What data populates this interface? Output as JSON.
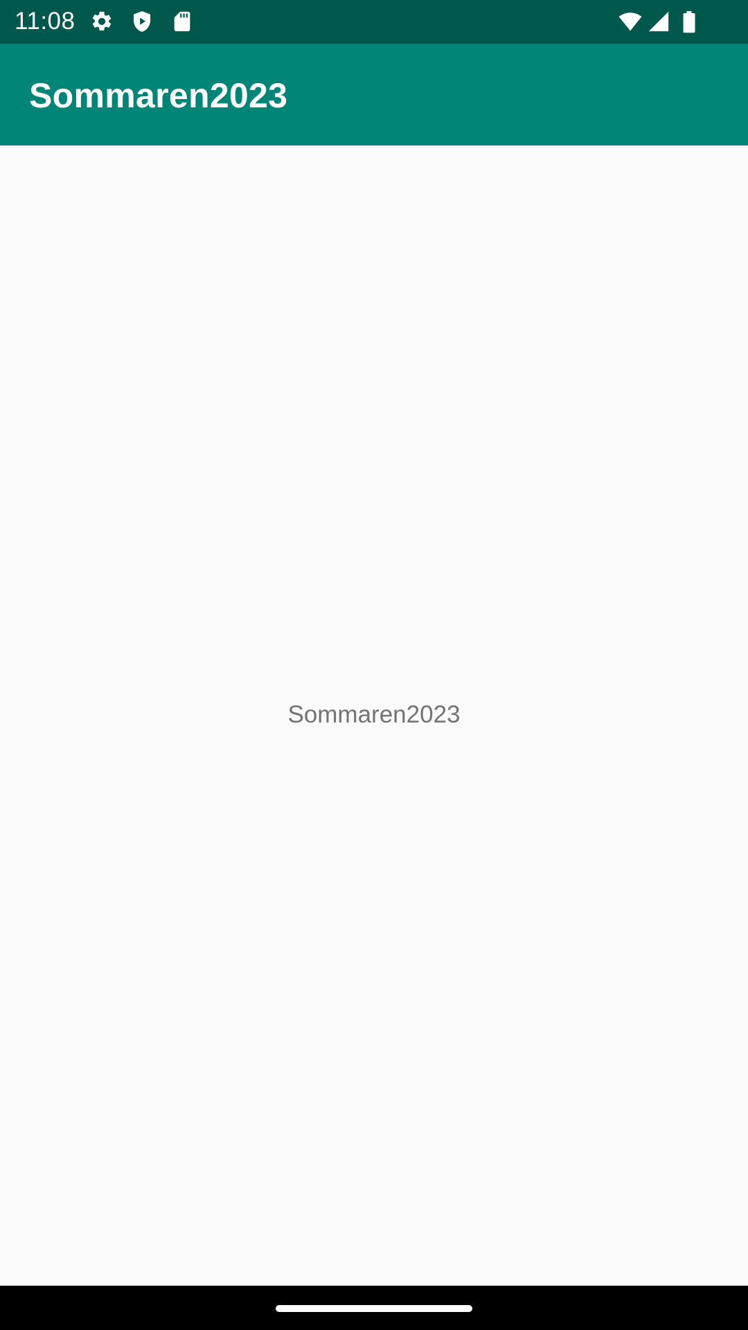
{
  "status_bar": {
    "time": "11:08",
    "background": "#00574b",
    "icons_left": [
      "settings-icon",
      "play-protect-icon",
      "sd-card-icon"
    ],
    "icons_right": [
      "wifi-icon",
      "cell-signal-icon",
      "battery-icon"
    ]
  },
  "app_bar": {
    "title": "Sommaren2023",
    "background": "#008577"
  },
  "main": {
    "center_text": "Sommaren2023",
    "background": "#fafafa"
  },
  "navigation_bar": {
    "background": "#000000",
    "handle": "home-handle"
  }
}
